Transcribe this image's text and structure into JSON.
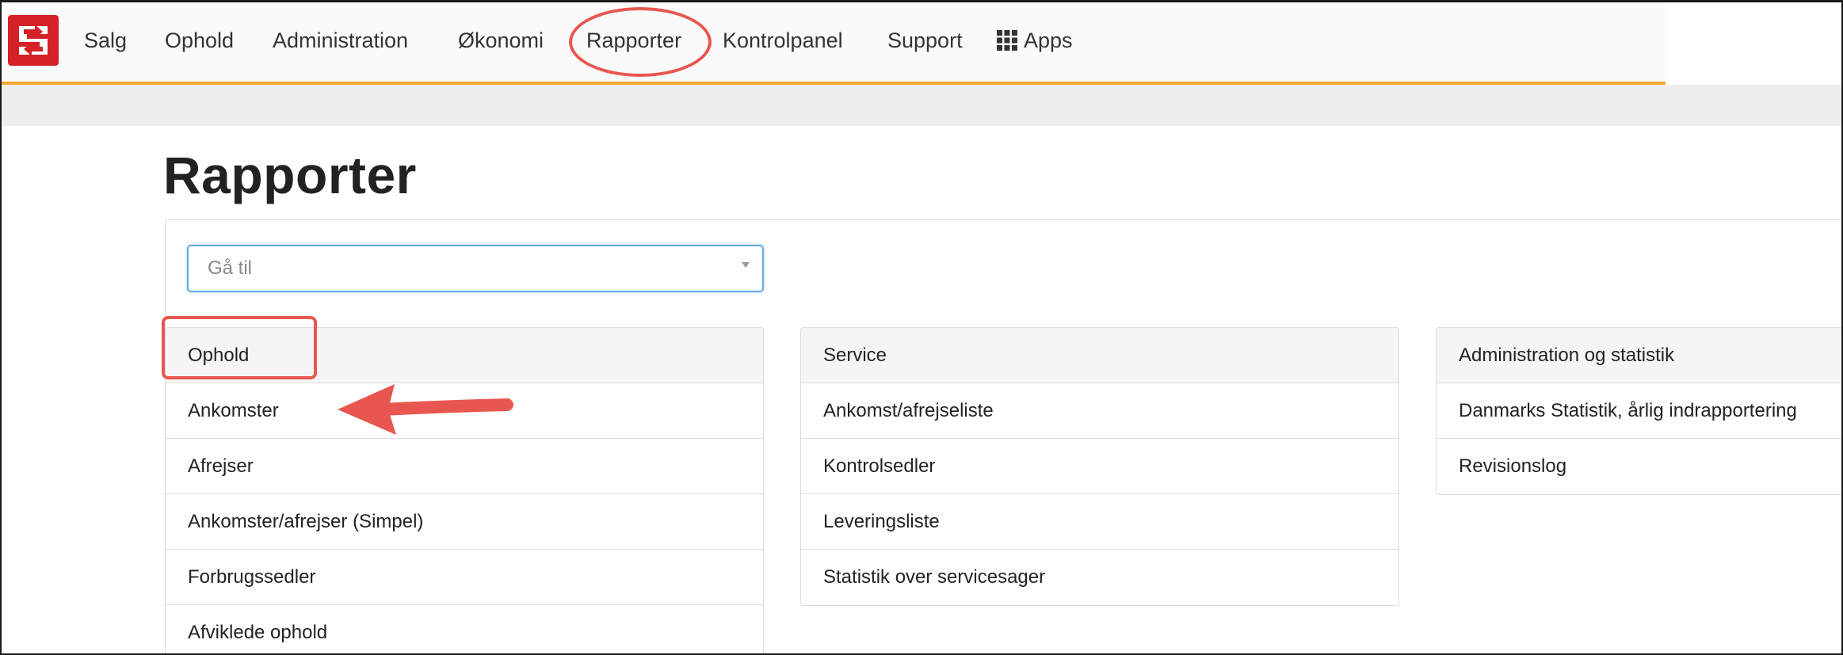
{
  "nav": {
    "items": [
      {
        "label": "Salg"
      },
      {
        "label": "Ophold"
      },
      {
        "label": "Administration"
      },
      {
        "label": "Økonomi"
      },
      {
        "label": "Rapporter"
      },
      {
        "label": "Kontrolpanel"
      },
      {
        "label": "Support"
      },
      {
        "label": "Apps"
      }
    ]
  },
  "page": {
    "title": "Rapporter",
    "goto_placeholder": "Gå til"
  },
  "groups": [
    {
      "header": "Ophold",
      "items": [
        "Ankomster",
        "Afrejser",
        "Ankomster/afrejser (Simpel)",
        "Forbrugssedler",
        "Afviklede ophold"
      ]
    },
    {
      "header": "Service",
      "items": [
        "Ankomst/afrejseliste",
        "Kontrolsedler",
        "Leveringsliste",
        "Statistik over servicesager"
      ]
    },
    {
      "header": "Administration og statistik",
      "items": [
        "Danmarks Statistik, årlig indrapportering",
        "Revisionslog"
      ]
    }
  ],
  "colors": {
    "brand": "#d32127",
    "accent_underline": "#f0a82e",
    "annotation": "#e8574f",
    "focus": "#66a8e0"
  },
  "icons": {
    "logo": "logo-icon",
    "apps": "grid-icon",
    "dropdown": "caret-down-icon",
    "annotation_arrow": "arrow-left-icon"
  }
}
